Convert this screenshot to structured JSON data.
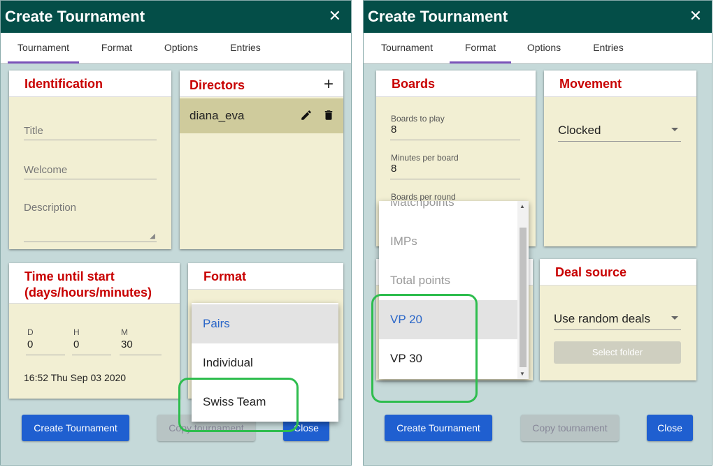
{
  "left_dialog": {
    "title": "Create Tournament",
    "close_glyph": "✕",
    "tabs": [
      "Tournament",
      "Format",
      "Options",
      "Entries"
    ],
    "active_tab": "Tournament",
    "identification": {
      "heading": "Identification",
      "title_placeholder": "Title",
      "welcome_placeholder": "Welcome",
      "description_placeholder": "Description"
    },
    "directors": {
      "heading": "Directors",
      "add_glyph": "+",
      "items": [
        {
          "name": "diana_eva"
        }
      ]
    },
    "time_until_start": {
      "heading_line1": "Time until start",
      "heading_line2": "(days/hours/minutes)",
      "d_label": "D",
      "d_value": "0",
      "h_label": "H",
      "h_value": "0",
      "m_label": "M",
      "m_value": "30",
      "start_time": "16:52 Thu Sep 03 2020"
    },
    "format": {
      "heading": "Format",
      "options": [
        "Pairs",
        "Individual",
        "Swiss Team"
      ],
      "selected": "Pairs"
    },
    "buttons": {
      "create": "Create Tournament",
      "copy": "Copy tournament",
      "close": "Close"
    }
  },
  "right_dialog": {
    "title": "Create Tournament",
    "close_glyph": "✕",
    "tabs": [
      "Tournament",
      "Format",
      "Options",
      "Entries"
    ],
    "active_tab": "Format",
    "boards": {
      "heading": "Boards",
      "boards_to_play_label": "Boards to play",
      "boards_to_play_value": "8",
      "minutes_per_board_label": "Minutes per board",
      "minutes_per_board_value": "8",
      "boards_per_round_label": "Boards per round"
    },
    "movement": {
      "heading": "Movement",
      "value": "Clocked"
    },
    "scoring_menu": {
      "options": [
        "Matchpoints",
        "IMPs",
        "Total points",
        "VP 20",
        "VP 30"
      ],
      "selected": "VP 20"
    },
    "deal_source": {
      "heading": "Deal source",
      "value": "Use random deals",
      "select_folder": "Select folder"
    },
    "buttons": {
      "create": "Create Tournament",
      "copy": "Copy tournament",
      "close": "Close"
    }
  },
  "colors": {
    "title_bar": "#044e48",
    "heading_red": "#c80000",
    "card_bg": "#f2efd3",
    "primary_button": "#1f5fd0",
    "highlight_green": "#2ebd4e",
    "active_tab_underline": "#7a52b8"
  }
}
